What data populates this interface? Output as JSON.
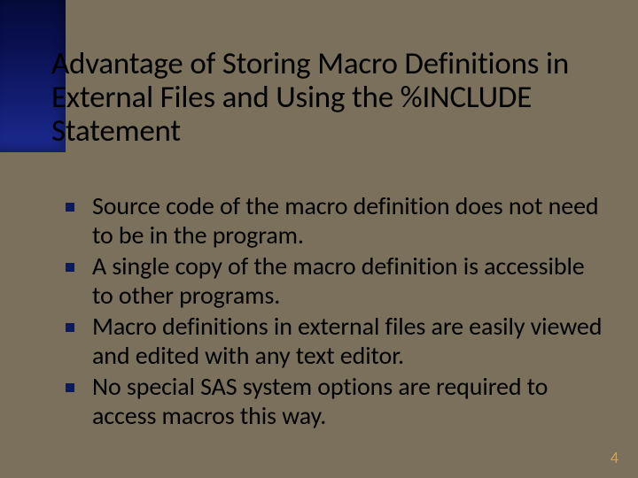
{
  "slide": {
    "title": "Advantage of Storing Macro Definitions in External Files and Using the %INCLUDE Statement",
    "bullets": [
      "Source code of the macro definition does not need to be in the program.",
      "A single copy of the macro definition is accessible to other programs.",
      "Macro definitions in external files are easily viewed and edited with any text editor.",
      "No special SAS system options are required to access macros this way."
    ],
    "page_number": "4"
  }
}
